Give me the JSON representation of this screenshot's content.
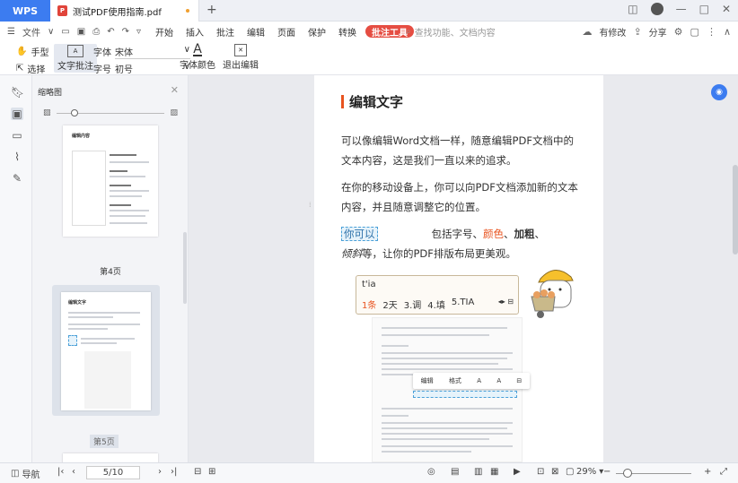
{
  "titlebar": {
    "app_tab": "WPS",
    "doc_tab": "测试PDF使用指南.pdf",
    "new_tab": "+"
  },
  "menubar": {
    "file": "文件",
    "items": [
      "开始",
      "插入",
      "批注",
      "编辑",
      "页面",
      "保护",
      "转换",
      "批注工具"
    ],
    "search_placeholder": "查找功能、文档内容",
    "has_changes": "有修改",
    "share": "分享"
  },
  "toolbar": {
    "hand": "手型",
    "select": "选择",
    "text_annotation": "文字批注",
    "font_label": "字体",
    "font_value": "宋体",
    "size_label": "字号",
    "size_value": "初号",
    "font_color": "字体颜色",
    "exit_edit": "退出编辑"
  },
  "thumbnails": {
    "title": "缩略图",
    "page4_label": "第4页",
    "page5_label": "第5页",
    "page4_heading": "编辑内容",
    "page5_heading": "编辑文字"
  },
  "document": {
    "heading": "编辑文字",
    "para1": "可以像编辑Word文档一样，随意编辑PDF文档中的文本内容，这是我们一直以来的追求。",
    "para2": "在你的移动设备上，你可以向PDF文档添加新的文本内容，并且随意调整它的位置。",
    "para3_hl": "你可以",
    "para3_a": "包括字号、",
    "para3_red": "颜色",
    "para3_b": "、",
    "para3_bold": "加粗",
    "para3_c": "、",
    "para3_italic": "倾斜",
    "para3_d": "等，让你的PDF排版布局更美观。",
    "ime_input": "t'ia",
    "ime_candidates": [
      "1条",
      "2天",
      "3.调",
      "4.填",
      "5.TIA"
    ],
    "mini_toolbar": [
      "编辑",
      "格式",
      "A",
      "A",
      "⊟"
    ]
  },
  "statusbar": {
    "nav": "导航",
    "page": "5/10",
    "zoom": "29%"
  },
  "colors": {
    "wps_blue": "#3c7cf0",
    "accent_red": "#e54d42",
    "heading_orange": "#e8531f"
  }
}
